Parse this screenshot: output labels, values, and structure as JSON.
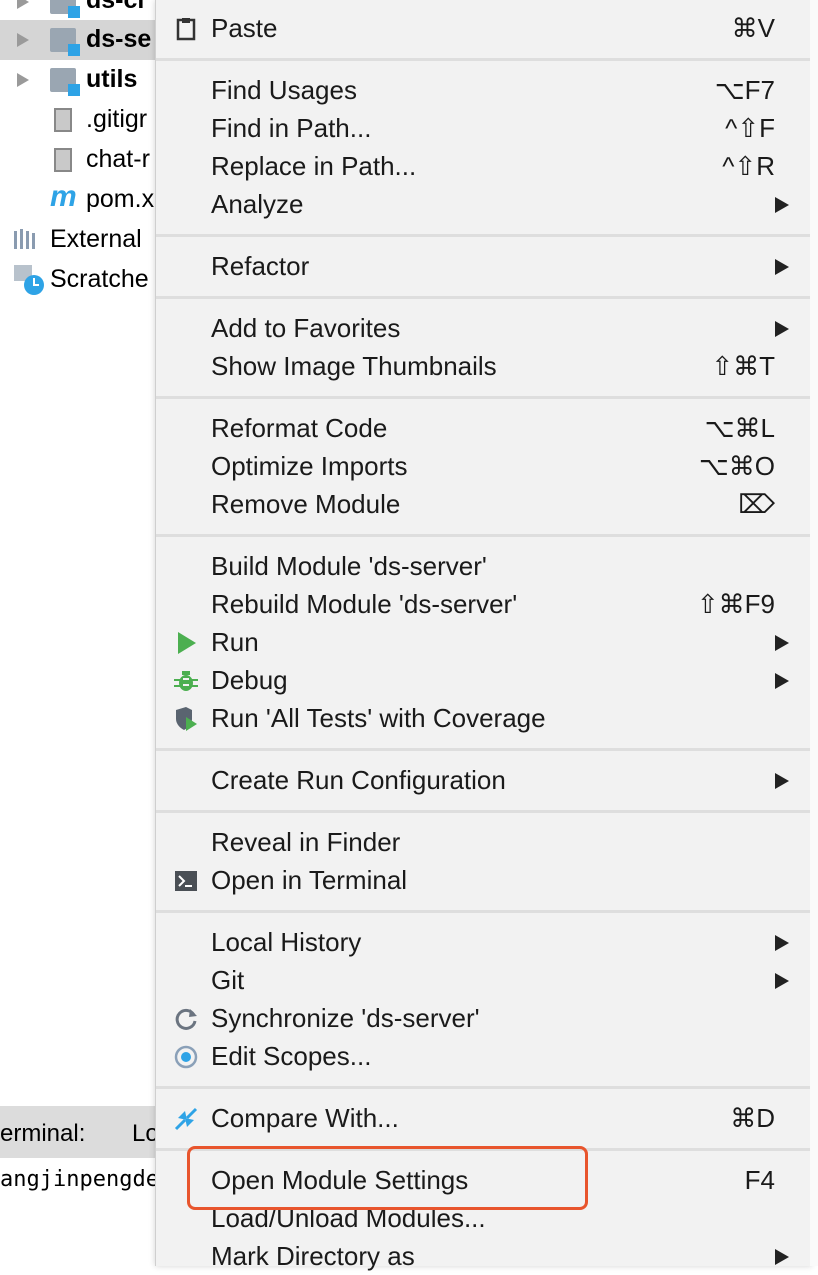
{
  "project_tree": {
    "items": [
      {
        "label": "ds-cl"
      },
      {
        "label": "ds-se"
      },
      {
        "label": "utils"
      },
      {
        "label": ".gitigr"
      },
      {
        "label": "chat-r"
      },
      {
        "label": "pom.x"
      },
      {
        "label": "External"
      },
      {
        "label": "Scratche"
      }
    ]
  },
  "terminal": {
    "tab_label": "erminal:",
    "tab2_label": "Lo",
    "prompt_text": "angjinpengde"
  },
  "context_menu": {
    "paste": {
      "label": "Paste",
      "shortcut": "⌘V",
      "icon": "clipboard-icon"
    },
    "find_usages": {
      "label": "Find Usages",
      "shortcut": "⌥F7"
    },
    "find_in_path": {
      "label": "Find in Path...",
      "shortcut": "^⇧F"
    },
    "replace_in_path": {
      "label": "Replace in Path...",
      "shortcut": "^⇧R"
    },
    "analyze": {
      "label": "Analyze"
    },
    "refactor": {
      "label": "Refactor"
    },
    "add_to_favorites": {
      "label": "Add to Favorites"
    },
    "show_image_thumbnails": {
      "label": "Show Image Thumbnails",
      "shortcut": "⇧⌘T"
    },
    "reformat_code": {
      "label": "Reformat Code",
      "shortcut": "⌥⌘L"
    },
    "optimize_imports": {
      "label": "Optimize Imports",
      "shortcut": "⌥⌘O"
    },
    "remove_module": {
      "label": "Remove Module",
      "shortcut": "⌦"
    },
    "build_module": {
      "label": "Build Module 'ds-server'"
    },
    "rebuild_module": {
      "label": "Rebuild Module 'ds-server'",
      "shortcut": "⇧⌘F9"
    },
    "run": {
      "label": "Run",
      "icon": "run-triangle-icon"
    },
    "debug": {
      "label": "Debug",
      "icon": "bug-icon"
    },
    "run_with_coverage": {
      "label": "Run 'All Tests' with Coverage",
      "icon": "coverage-shield-icon"
    },
    "create_run_configuration": {
      "label": "Create Run Configuration"
    },
    "reveal_in_finder": {
      "label": "Reveal in Finder"
    },
    "open_in_terminal": {
      "label": "Open in Terminal",
      "icon": "terminal-icon"
    },
    "local_history": {
      "label": "Local History"
    },
    "git": {
      "label": "Git"
    },
    "synchronize": {
      "label": "Synchronize 'ds-server'",
      "icon": "sync-icon"
    },
    "edit_scopes": {
      "label": "Edit Scopes...",
      "icon": "scope-icon"
    },
    "compare_with": {
      "label": "Compare With...",
      "shortcut": "⌘D",
      "icon": "compare-arrows-icon"
    },
    "open_module_settings": {
      "label": "Open Module Settings",
      "shortcut": "F4"
    },
    "load_unload_modules": {
      "label": "Load/Unload Modules..."
    },
    "mark_directory_as": {
      "label": "Mark Directory as"
    }
  },
  "colors": {
    "highlight_border": "#e8552d",
    "run_green": "#4caf50",
    "icon_blue": "#2ea3e6"
  }
}
